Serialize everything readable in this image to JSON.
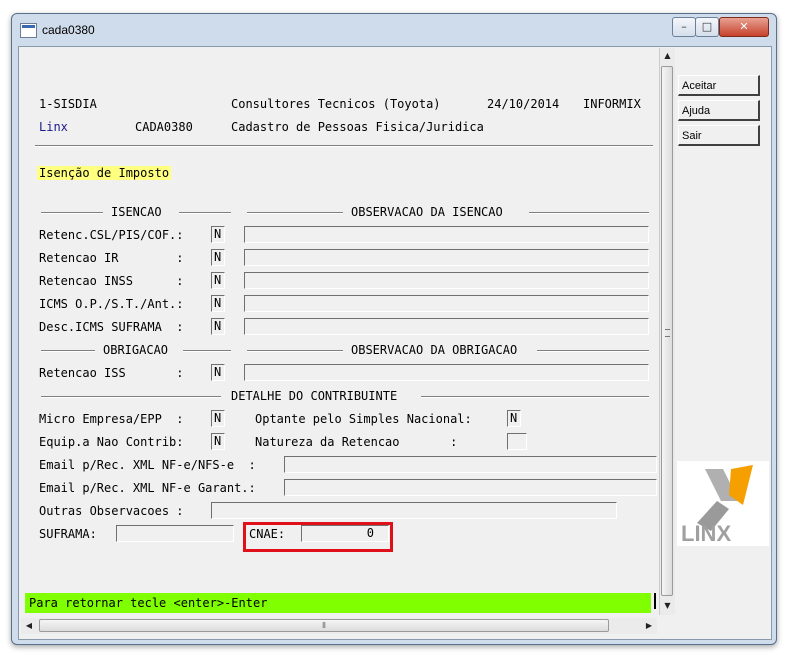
{
  "window": {
    "title": "cada0380",
    "min_label": "–",
    "max_label": "□",
    "close_label": "✕"
  },
  "header": {
    "system": "1-SISDIA",
    "company": "Consultores Tecnicos (Toyota)",
    "date": "24/10/2014",
    "db": "INFORMIX",
    "brand": "Linx",
    "program": "CADA0380",
    "program_title": "Cadastro de Pessoas Fisica/Juridica"
  },
  "section_title": "Isenção de Imposto",
  "isencao": {
    "heading": "ISENCAO",
    "obs_heading": "OBSERVACAO DA ISENCAO",
    "rows": [
      {
        "label": "Retenc.CSL/PIS/COF.:",
        "value": "N",
        "obs": ""
      },
      {
        "label": "Retencao IR        :",
        "value": "N",
        "obs": ""
      },
      {
        "label": "Retencao INSS      :",
        "value": "N",
        "obs": ""
      },
      {
        "label": "ICMS O.P./S.T./Ant.:",
        "value": "N",
        "obs": ""
      },
      {
        "label": "Desc.ICMS SUFRAMA  :",
        "value": "N",
        "obs": ""
      }
    ]
  },
  "obrigacao": {
    "heading": "OBRIGACAO",
    "obs_heading": "OBSERVACAO DA OBRIGACAO",
    "rows": [
      {
        "label": "Retencao ISS       :",
        "value": "N",
        "obs": ""
      }
    ]
  },
  "contribuinte": {
    "heading": "DETALHE DO CONTRIBUINTE",
    "micro_label": "Micro Empresa/EPP  :",
    "micro_value": "N",
    "simples_label": "Optante pelo Simples Nacional:",
    "simples_value": "N",
    "equip_label": "Equip.a Nao Contrib:",
    "equip_value": "N",
    "natureza_label": "Natureza da Retencao       :",
    "natureza_value": "",
    "email_nfe_label": "Email p/Rec. XML NF-e/NFS-e  :",
    "email_nfe_value": "",
    "email_garant_label": "Email p/Rec. XML NF-e Garant.:",
    "email_garant_value": "",
    "outras_label": "Outras Observacoes :",
    "outras_value": "",
    "suframa_label": "SUFRAMA:",
    "suframa_value": "",
    "cnae_label": "CNAE:",
    "cnae_value": "0"
  },
  "status_line": "Para retornar tecle <enter>-Enter",
  "side_buttons": {
    "accept": "Aceitar",
    "help": "Ajuda",
    "exit": "Sair"
  },
  "logo_text": "LINX",
  "colors": {
    "status_bg": "#80ff00",
    "section_bg": "#ffff80",
    "highlight_border": "#e0101a",
    "logo_orange": "#f5a000"
  }
}
